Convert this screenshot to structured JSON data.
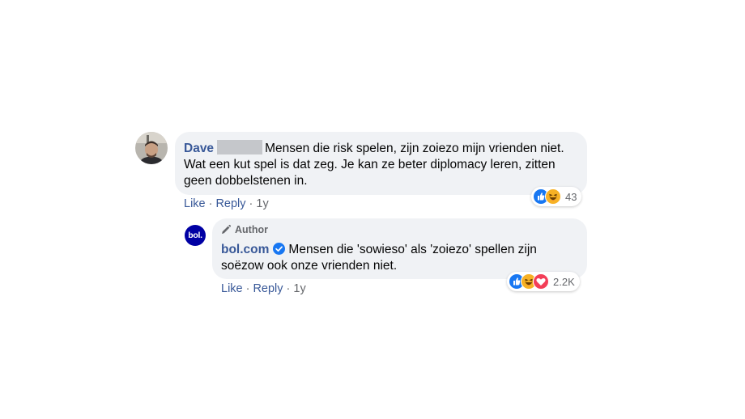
{
  "comment": {
    "author": "Dave",
    "text": "Mensen die risk spelen, zijn zoiezo mijn vrienden niet. Wat een kut spel is dat zeg. Je kan ze beter diplomacy leren, zitten geen dobbelstenen in.",
    "actions": {
      "like": "Like",
      "reply": "Reply",
      "time": "1y"
    },
    "reactions": {
      "icons": [
        "like-icon",
        "haha-icon"
      ],
      "count": "43"
    }
  },
  "reply": {
    "badge": "Author",
    "author": "bol.com",
    "avatar_text": "bol.",
    "text": "Mensen die 'sowieso' als 'zoiezo' spellen zijn soëzow ook onze vrienden niet.",
    "actions": {
      "like": "Like",
      "reply": "Reply",
      "time": "1y"
    },
    "reactions": {
      "icons": [
        "like-icon",
        "haha-icon",
        "love-icon"
      ],
      "count": "2.2K"
    }
  },
  "colors": {
    "link": "#385898",
    "bubble": "#f0f2f5",
    "like": "#1877f2",
    "love": "#f33e58",
    "haha": "#f7b125",
    "bol_brand": "#0000a4"
  }
}
